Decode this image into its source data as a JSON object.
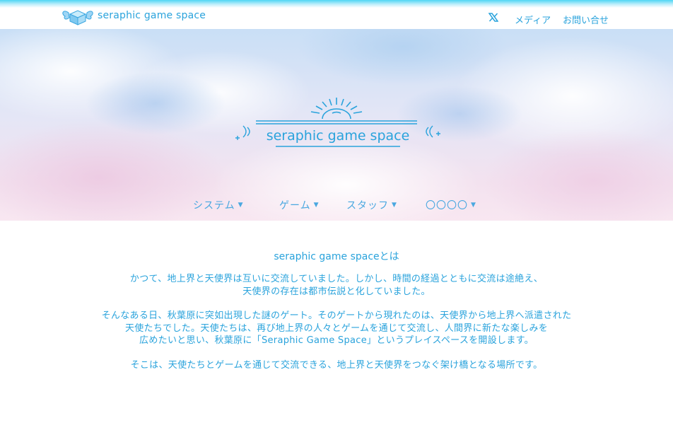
{
  "header": {
    "site_title": "seraphic game space",
    "nav": [
      {
        "label": "メディア"
      },
      {
        "label": "お問い合せ"
      }
    ]
  },
  "hero": {
    "emblem_text": "seraphic game space"
  },
  "menu": [
    {
      "label": "システム"
    },
    {
      "label": "ゲーム"
    },
    {
      "label": "スタッフ"
    },
    {
      "label": "〇〇〇〇"
    }
  ],
  "about": {
    "title": "seraphic game spaceとは",
    "p1": [
      "かつて、地上界と天使界は互いに交流していました。しかし、時間の経過とともに交流は途絶え、",
      "天使界の存在は都市伝説と化していました。"
    ],
    "p2": [
      "そんなある日、秋葉原に突如出現した謎のゲート。そのゲートから現れたのは、天使界から地上界へ派遣された",
      "天使たちでした。天使たちは、再び地上界の人々とゲームを通じて交流し、人間界に新たな楽しみを",
      "広めたいと思い、秋葉原に「Seraphic Game Space」というプレイスペースを開設します。"
    ],
    "p3": [
      "そこは、天使たちとゲームを通じて交流できる、地上界と天使界をつなぐ架け橋となる場所です。"
    ]
  },
  "colors": {
    "accent": "#2aa3dc",
    "top_gradient": "#4fd6f4"
  }
}
